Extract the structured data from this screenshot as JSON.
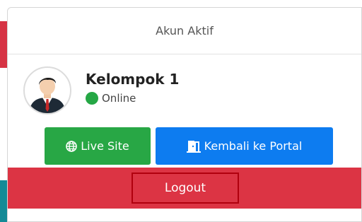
{
  "header": {
    "title": "Akun Aktif"
  },
  "user": {
    "name": "Kelompok 1",
    "status": "Online"
  },
  "buttons": {
    "live_site": "Live Site",
    "portal": "Kembali ke Portal",
    "logout": "Logout"
  },
  "icons": {
    "live_site": "globe-icon",
    "portal": "door-exit-icon",
    "status": "status-dot-icon"
  },
  "colors": {
    "online": "#25a745",
    "live_site_bg": "#28a745",
    "portal_bg": "#0d7cf0",
    "logout_bg": "#dc3444"
  }
}
